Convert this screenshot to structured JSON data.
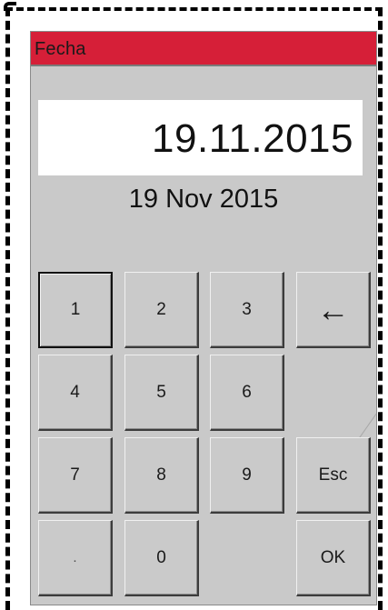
{
  "dialog": {
    "title": "Fecha",
    "date_value": "19.11.2015",
    "date_long": "19 Nov 2015"
  },
  "colors": {
    "titlebar": "#d61f38",
    "background": "#c9c9c9"
  },
  "keypad": {
    "k1": "1",
    "k2": "2",
    "k3": "3",
    "backspace": "←",
    "k4": "4",
    "k5": "5",
    "k6": "6",
    "k7": "7",
    "k8": "8",
    "k9": "9",
    "esc": "Esc",
    "dot": ".",
    "k0": "0",
    "ok": "OK"
  }
}
